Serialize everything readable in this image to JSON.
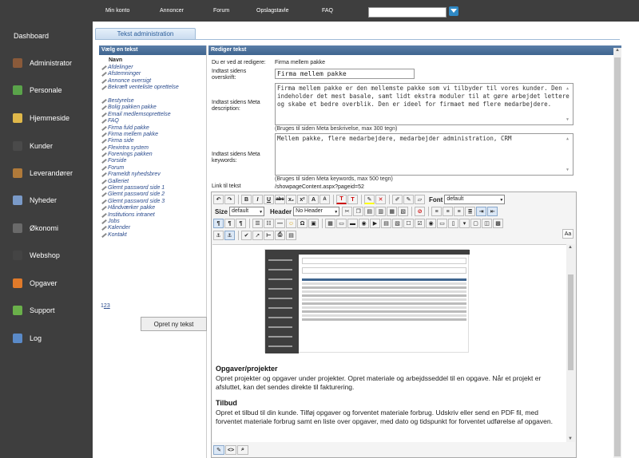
{
  "sidebar": {
    "dashboard": "Dashboard",
    "items": [
      {
        "label": "Administrator",
        "icon": "admin-icon",
        "color": "#8a5a3a"
      },
      {
        "label": "Personale",
        "icon": "personnel-icon",
        "color": "#5aa34a"
      },
      {
        "label": "Hjemmeside",
        "icon": "website-icon",
        "color": "#e0b84a"
      },
      {
        "label": "Kunder",
        "icon": "customers-icon",
        "color": "#4a4a4a"
      },
      {
        "label": "Leverandører",
        "icon": "suppliers-icon",
        "color": "#b07a3a"
      },
      {
        "label": "Nyheder",
        "icon": "news-icon",
        "color": "#7a9ac8"
      },
      {
        "label": "Økonomi",
        "icon": "economy-icon",
        "color": "#6a6a6a"
      },
      {
        "label": "Webshop",
        "icon": "webshop-icon",
        "color": "#444"
      },
      {
        "label": "Opgaver",
        "icon": "tasks-icon",
        "color": "#e07a2a"
      },
      {
        "label": "Support",
        "icon": "support-icon",
        "color": "#6ab04a"
      },
      {
        "label": "Log",
        "icon": "log-icon",
        "color": "#5a8ac8"
      }
    ]
  },
  "topnav": {
    "links": [
      "Min konto",
      "Annoncer",
      "Forum",
      "Opslagstavle",
      "FAQ"
    ],
    "search_placeholder": ""
  },
  "tab": "Tekst administration",
  "left": {
    "title": "Vælg en tekst",
    "column": "Navn",
    "items": [
      "Afdelinger",
      "Afstemninger",
      "Annonce oversigt",
      "Bekræft venteliste oprettelse",
      "Bestyrelse",
      "Bolig pakken pakke",
      "Email medlemsoprettelse",
      "FAQ",
      "Firma fuld pakke",
      "Firma mellem pakke",
      "Firma side",
      "Flexintra system",
      "Forenings pakken",
      "Forside",
      "Forum",
      "Frameldt nyhedsbrev",
      "Galleriet",
      "Glemt password side 1",
      "Glemt password side 2",
      "Glemt password side 3",
      "Håndværker pakke",
      "Institutions intranet",
      "Jobs",
      "Kalender",
      "Kontakt"
    ],
    "pages": [
      "1",
      "2",
      "3"
    ],
    "create_button": "Opret ny tekst"
  },
  "right": {
    "title": "Rediger tekst",
    "editing_label": "Du er ved at redigere:",
    "editing_value": "Firma mellem pakke",
    "headline_label": "Indtast sidens overskrift:",
    "headline_value": "Firma mellem pakke",
    "meta_desc_label": "Indtast sidens Meta description:",
    "meta_desc_value": "Firma mellem pakke er den mellemste pakke som vi tilbyder til vores kunder. Den indeholder det mest basale, samt lidt ekstra moduler til at gøre arbejdet lettere og skabe et bedre overblik. Den er ideel for firmaet med flere medarbejdere.",
    "meta_desc_help": "(Bruges til siden Meta beskrivelse, max 300 tegn)",
    "meta_kw_label": "Indtast sidens Meta keywords:",
    "meta_kw_value": "Mellem pakke, flere medarbejdere, medarbejder administration, CRM",
    "meta_kw_help": "(Bruges til siden Meta keywords, max 500 tegn)",
    "link_label": "Link til tekst",
    "link_value": "/showpageContent.aspx?pageid=52"
  },
  "editor": {
    "font_label": "Font",
    "font_value": "default",
    "size_label": "Size",
    "size_value": "default",
    "header_label": "Header",
    "header_value": "No Header",
    "aa_label": "Aa",
    "sections": [
      {
        "heading": "Opgaver/projekter",
        "text": "Opret projekter og opgaver under projekter. Opret materiale og arbejdsseddel til en opgave. Når et projekt er afsluttet, kan det sendes direkte til fakturering."
      },
      {
        "heading": "Tilbud",
        "text": "Opret et tilbud til din kunde. Tilføj opgaver og forventet materiale forbrug. Udskriv eller send en PDF fil, med forventet materiale forbrug samt en liste over opgaver, med dato og tidspunkt for forventet udførelse af opgaven."
      }
    ]
  },
  "colors": {
    "sidebar": "#3e3e3e",
    "panel_header": "#4a6f9a",
    "link": "#2a4b8d"
  }
}
